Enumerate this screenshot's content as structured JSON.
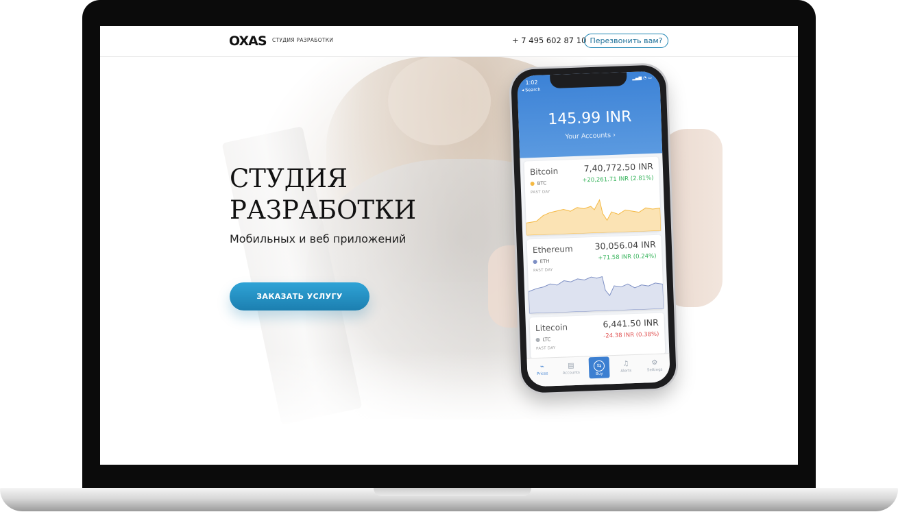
{
  "header": {
    "logo": "OXAS",
    "logo_subtitle": "СТУДИЯ РАЗРАБОТКИ",
    "phone": "+ 7 495 602 87 10",
    "callback_label": "Перезвонить вам?"
  },
  "hero": {
    "title_line1": "СТУДИЯ",
    "title_line2": "РАЗРАБОТКИ",
    "subtitle": "Мобильных и веб приложений",
    "cta_label": "ЗАКАЗАТЬ УСЛУГУ"
  },
  "phone_app": {
    "status_time": "1:02",
    "status_back": "◂ Search",
    "balance": "145.99 INR",
    "accounts_link": "Your Accounts ›",
    "coins": [
      {
        "name": "Bitcoin",
        "ticker": "BTC",
        "price": "7,40,772.50 INR",
        "change": "+20,261.71 INR (2.81%)",
        "period": "PAST DAY",
        "color": "#f5b942",
        "change_color": "#35b35a"
      },
      {
        "name": "Ethereum",
        "ticker": "ETH",
        "price": "30,056.04 INR",
        "change": "+71.58 INR (0.24%)",
        "period": "PAST DAY",
        "color": "#7d8fc4",
        "change_color": "#35b35a"
      },
      {
        "name": "Litecoin",
        "ticker": "LTC",
        "price": "6,441.50 INR",
        "change": "-24.38 INR (0.38%)",
        "period": "PAST DAY",
        "color": "#a9aeb4",
        "change_color": "#e05252"
      }
    ],
    "tabs": [
      {
        "label": "Prices",
        "icon": "chart-icon"
      },
      {
        "label": "Accounts",
        "icon": "accounts-icon"
      },
      {
        "label": "Buy",
        "icon": "buy-icon"
      },
      {
        "label": "Alerts",
        "icon": "bell-icon"
      },
      {
        "label": "Settings",
        "icon": "gear-icon"
      }
    ]
  }
}
